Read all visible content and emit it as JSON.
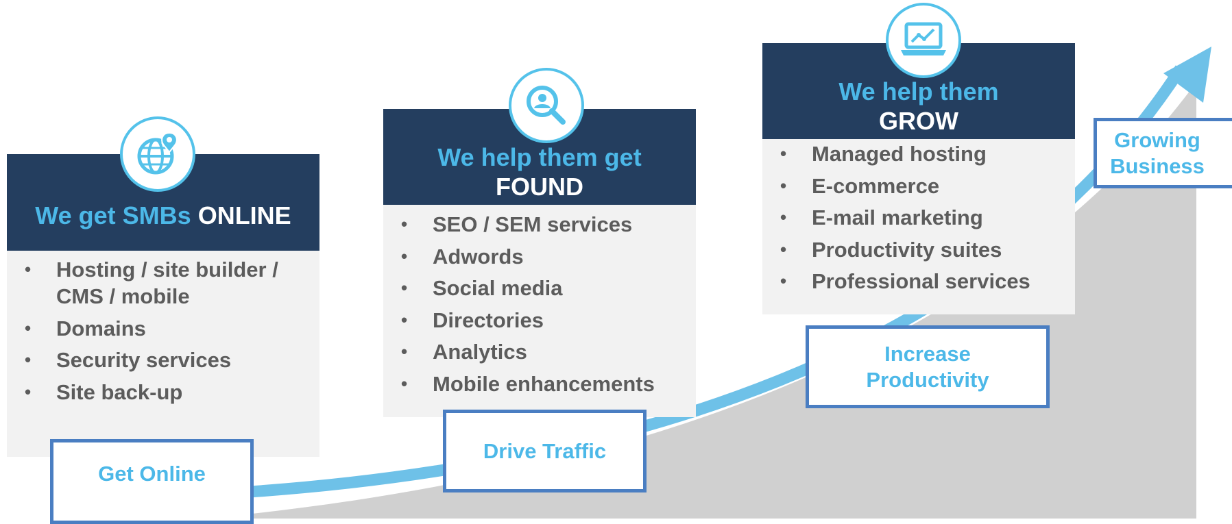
{
  "cards": [
    {
      "head_accent": "We get SMBs",
      "head_strong": "ONLINE",
      "icon": "globe-pin-icon",
      "items": [
        "Hosting / site builder / CMS / mobile",
        "Domains",
        "Security services",
        "Site back-up"
      ]
    },
    {
      "head_accent": "We help them get",
      "head_strong": "FOUND",
      "icon": "magnifier-person-icon",
      "items": [
        "SEO / SEM services",
        "Adwords",
        "Social media",
        "Directories",
        "Analytics",
        "Mobile enhancements"
      ]
    },
    {
      "head_accent": "We help them",
      "head_strong": "GROW",
      "icon": "laptop-chart-icon",
      "items": [
        "Managed hosting",
        "E-commerce",
        "E-mail marketing",
        "Productivity suites",
        "Professional services"
      ]
    }
  ],
  "stages": [
    {
      "line1": "Get Online",
      "line2": ""
    },
    {
      "line1": "Drive Traffic",
      "line2": ""
    },
    {
      "line1": "Increase",
      "line2": "Productivity"
    },
    {
      "line1": "Growing",
      "line2": "Business"
    }
  ],
  "bullet": "•",
  "colors": {
    "header_bg": "#243e5f",
    "accent": "#4cb8e8",
    "body_text": "#5c5c5c",
    "card_bg": "#f2f2f2",
    "stage_border": "#4a7ec2",
    "growth_area": "#d0d0d0",
    "arrow": "#6ec1e8"
  }
}
